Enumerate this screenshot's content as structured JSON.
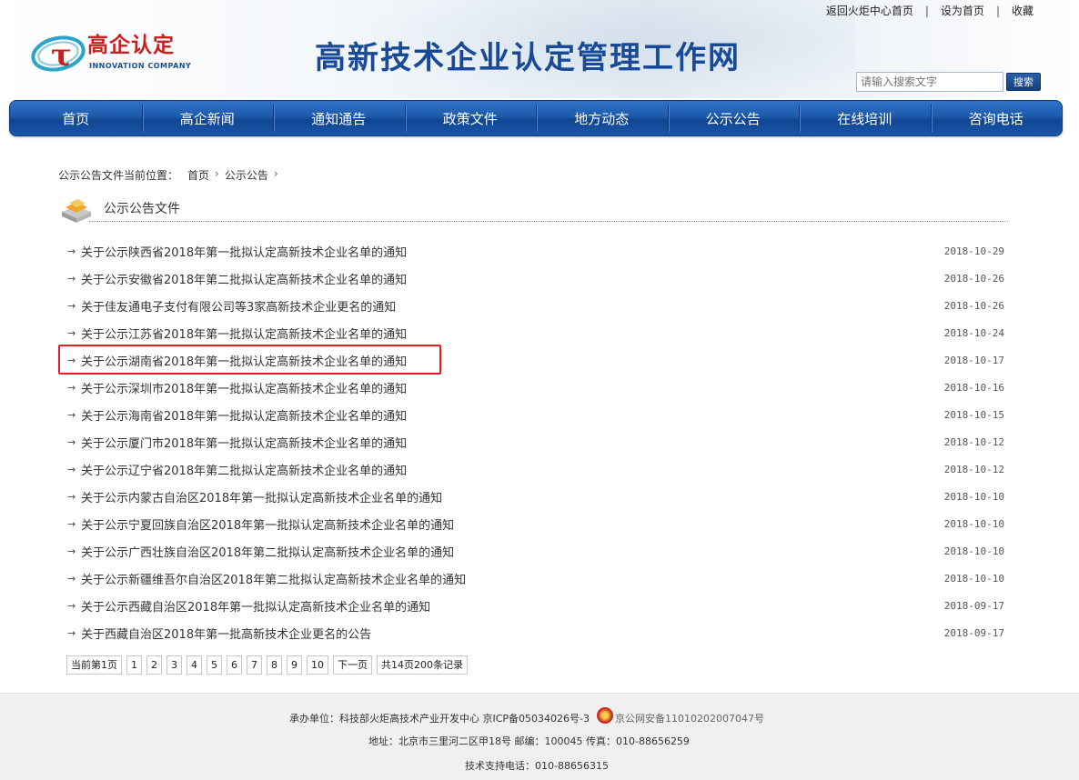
{
  "header": {
    "top_links": [
      "返回火炬中心首页",
      "设为首页",
      "收藏"
    ],
    "logo_cn": "高企认定",
    "logo_en": "INNOVATION COMPANY",
    "site_title": "高新技术企业认定管理工作网",
    "search_placeholder": "请输入搜索文字",
    "search_button": "搜索"
  },
  "nav": [
    "首页",
    "高企新闻",
    "通知通告",
    "政策文件",
    "地方动态",
    "公示公告",
    "在线培训",
    "咨询电话"
  ],
  "breadcrumb": {
    "prefix": "公示公告文件当前位置：",
    "items": [
      "首页",
      "公示公告"
    ]
  },
  "section_title": "公示公告文件",
  "list": [
    {
      "title": "关于公示陕西省2018年第一批拟认定高新技术企业名单的通知",
      "date": "2018-10-29"
    },
    {
      "title": "关于公示安徽省2018年第二批拟认定高新技术企业名单的通知",
      "date": "2018-10-26"
    },
    {
      "title": "关于佳友通电子支付有限公司等3家高新技术企业更名的通知",
      "date": "2018-10-26"
    },
    {
      "title": "关于公示江苏省2018年第一批拟认定高新技术企业名单的通知",
      "date": "2018-10-24"
    },
    {
      "title": "关于公示湖南省2018年第一批拟认定高新技术企业名单的通知",
      "date": "2018-10-17"
    },
    {
      "title": "关于公示深圳市2018年第一批拟认定高新技术企业名单的通知",
      "date": "2018-10-16"
    },
    {
      "title": "关于公示海南省2018年第一批拟认定高新技术企业名单的通知",
      "date": "2018-10-15"
    },
    {
      "title": "关于公示厦门市2018年第一批拟认定高新技术企业名单的通知",
      "date": "2018-10-12"
    },
    {
      "title": "关于公示辽宁省2018年第二批拟认定高新技术企业名单的通知",
      "date": "2018-10-12"
    },
    {
      "title": "关于公示内蒙古自治区2018年第一批拟认定高新技术企业名单的通知",
      "date": "2018-10-10"
    },
    {
      "title": "关于公示宁夏回族自治区2018年第一批拟认定高新技术企业名单的通知",
      "date": "2018-10-10"
    },
    {
      "title": "关于公示广西壮族自治区2018年第二批拟认定高新技术企业名单的通知",
      "date": "2018-10-10"
    },
    {
      "title": "关于公示新疆维吾尔自治区2018年第二批拟认定高新技术企业名单的通知",
      "date": "2018-10-10"
    },
    {
      "title": "关于公示西藏自治区2018年第一批拟认定高新技术企业名单的通知",
      "date": "2018-09-17"
    },
    {
      "title": "关于西藏自治区2018年第一批高新技术企业更名的公告",
      "date": "2018-09-17"
    }
  ],
  "pager": [
    "当前第1页",
    "1",
    "2",
    "3",
    "4",
    "5",
    "6",
    "7",
    "8",
    "9",
    "10",
    "下一页",
    "共14页200条记录"
  ],
  "footer": {
    "organizer": "承办单位：科技部火炬高技术产业开发中心 京ICP备05034026号-3",
    "police": "京公网安备11010202007047号",
    "address": "地址：北京市三里河二区甲18号 邮编：100045 传真：010-88656259",
    "support": "技术支持电话：010-88656315"
  },
  "colors": {
    "nav": "#1d5aab",
    "title": "#184a97",
    "logo_red": "#c62020",
    "highlight": "#e02020"
  }
}
